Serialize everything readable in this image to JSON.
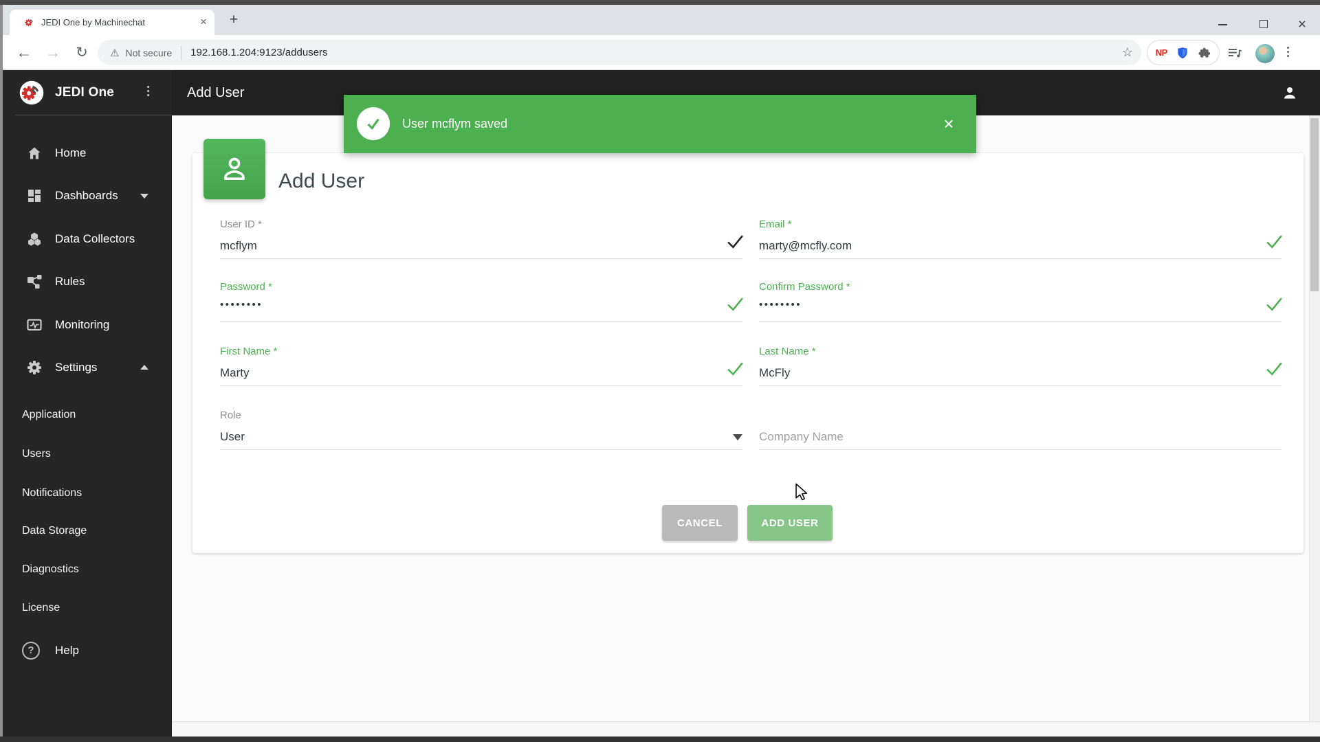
{
  "colors": {
    "accent_green": "#4caf50",
    "disabled_green": "#85c688",
    "cancel_gray": "#b9b9b9",
    "sidebar_bg": "#262626",
    "appbar_bg": "#212121",
    "toast_green": "#4caf50"
  },
  "browser": {
    "tab_title": "JEDI One by Machinechat",
    "tab_close_glyph": "×",
    "new_tab_glyph": "+",
    "window_close_glyph": "×",
    "back_glyph": "←",
    "forward_glyph": "→",
    "refresh_glyph": "↻",
    "warning_glyph": "⚠",
    "security_label": "Not secure",
    "url": "192.168.1.204:9123/addusers",
    "star_glyph": "☆",
    "extension_np": "NP"
  },
  "appbar": {
    "title": "Add User"
  },
  "toast": {
    "message": "User mcflym saved",
    "close_glyph": "×"
  },
  "sidebar": {
    "brand": "JEDI One",
    "items": [
      {
        "label": "Home"
      },
      {
        "label": "Dashboards"
      },
      {
        "label": "Data Collectors"
      },
      {
        "label": "Rules"
      },
      {
        "label": "Monitoring"
      },
      {
        "label": "Settings"
      }
    ],
    "subitems": [
      {
        "label": "Application"
      },
      {
        "label": "Users"
      },
      {
        "label": "Notifications"
      },
      {
        "label": "Data Storage"
      },
      {
        "label": "Diagnostics"
      },
      {
        "label": "License"
      }
    ],
    "help_label": "Help",
    "help_glyph": "?"
  },
  "form": {
    "title": "Add User",
    "user_id": {
      "label": "User ID *",
      "value": "mcflym"
    },
    "email": {
      "label": "Email *",
      "value": "marty@mcfly.com"
    },
    "password": {
      "label": "Password *",
      "value": "••••••••"
    },
    "confirm_password": {
      "label": "Confirm Password *",
      "value": "••••••••"
    },
    "first_name": {
      "label": "First Name *",
      "value": "Marty"
    },
    "last_name": {
      "label": "Last Name *",
      "value": "McFly"
    },
    "role": {
      "label": "Role",
      "value": "User"
    },
    "company": {
      "placeholder": "Company Name"
    },
    "cancel_label": "CANCEL",
    "submit_label": "ADD USER"
  }
}
